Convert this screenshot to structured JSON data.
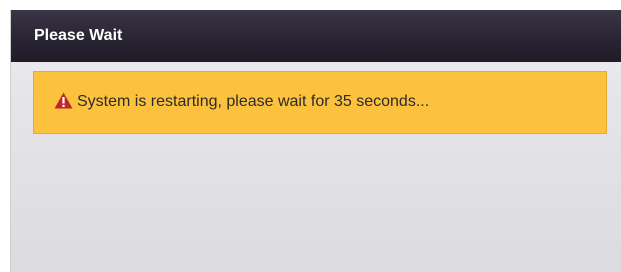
{
  "dialog": {
    "title": "Please Wait"
  },
  "alert": {
    "icon": "warning-triangle-icon",
    "message": "System is restarting, please wait for 35 seconds...",
    "background_color": "#fcc23e",
    "icon_color": "#c0272d"
  }
}
